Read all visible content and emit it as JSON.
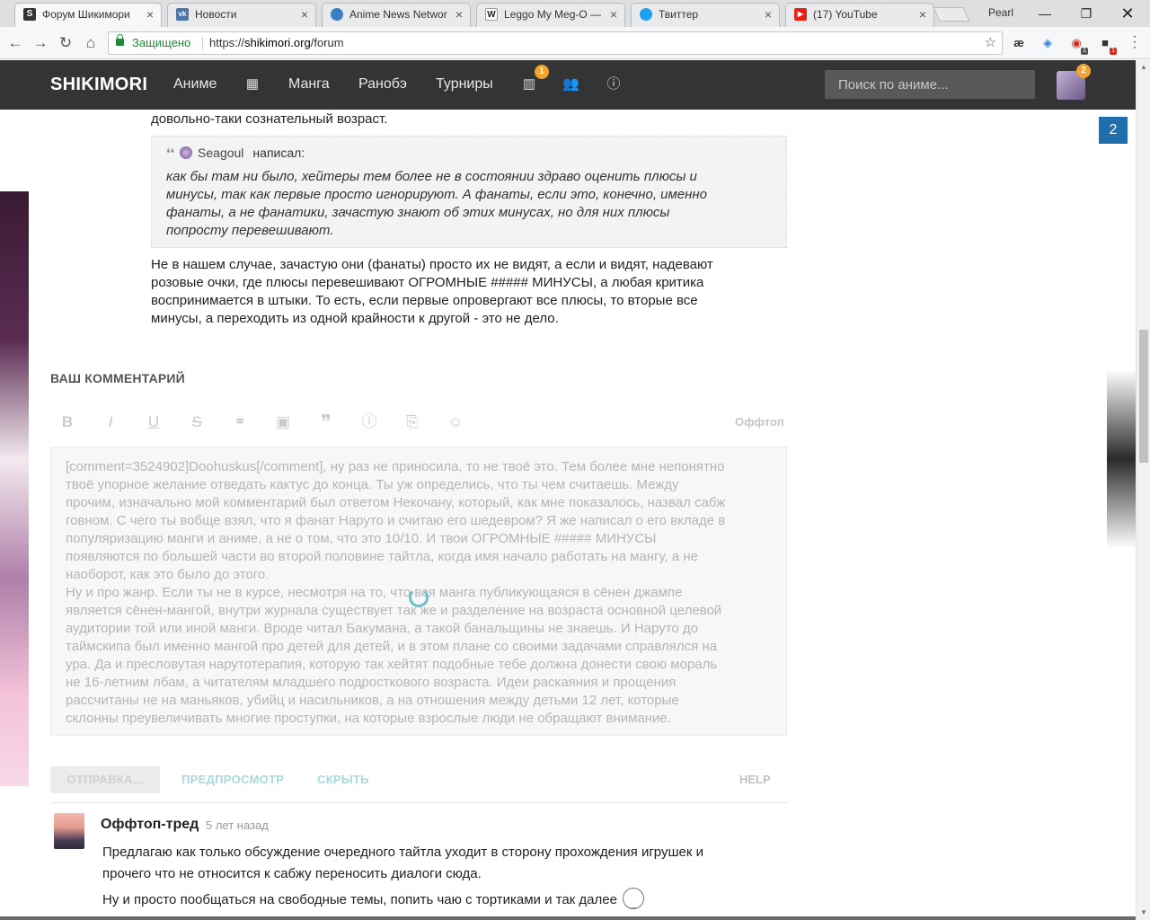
{
  "browser": {
    "tabs": [
      {
        "title": "Форум Шикимори",
        "favicon": "S",
        "color": "#343434"
      },
      {
        "title": "Новости",
        "favicon": "vk",
        "color": "#4a76a8"
      },
      {
        "title": "Anime News Networ",
        "favicon": "ann",
        "color": "#3a7fc1"
      },
      {
        "title": "Leggo My Meg-O —",
        "favicon": "W",
        "color": "#ffffff"
      },
      {
        "title": "Твиттер",
        "favicon": "twitter-bird",
        "color": "#1da1f2"
      },
      {
        "title": "(17) YouTube",
        "favicon": "youtube-play",
        "color": "#e62117"
      }
    ],
    "profile_name": "Pearl",
    "secure_label": "Защищено",
    "url_scheme": "https://",
    "url_host": "shikimori.org",
    "url_path": "/forum",
    "ext_icons": [
      "ae-icon",
      "shield-icon",
      "adblock-icon",
      "extension-icon"
    ],
    "ext_badges": [
      "1",
      "1"
    ]
  },
  "site": {
    "logo": "SHIKIMORI",
    "nav": [
      "Аниме",
      "Манга",
      "Ранобэ",
      "Турниры"
    ],
    "news_badge": "1",
    "avatar_badge": "2",
    "search_placeholder": "Поиск по аниме...",
    "counter": "2",
    "accent": "#1f6fae"
  },
  "prev_comment": {
    "top_line": "довольно-таки сознательный возраст.",
    "quote_user": "Seagoul",
    "quote_wrote": "написал:",
    "quote_lines": [
      "как бы там ни было, хейтеры тем более не в состоянии здраво оценить плюсы и",
      "минусы, так как первые просто игнорируют. А фанаты, если это, конечно, именно",
      "фанаты, а не фанатики, зачастую знают об этих минусах, но для них плюсы",
      "попросту перевешивают."
    ],
    "reply_lines": [
      "Не в нашем случае, зачастую они (фанаты) просто их не видят, а если и видят, надевают",
      "розовые очки, где плюсы перевешивают ОГРОМНЫЕ ##### МИНУСЫ, а любая критика",
      "воспринимается в штыки. То есть, если первые опровергают все плюсы, то вторые все",
      "минусы, а переходить из одной крайности к другой - это не дело."
    ]
  },
  "editor": {
    "section_title": "ВАШ КОММЕНТАРИЙ",
    "offtop_label": "Оффтоп",
    "lines": [
      "[comment=3524902]Doohuskus[/comment], ну раз не приносила, то не твоё это. Тем более мне непонятно",
      "твоё упорное желание отведать кактус до конца. Ты уж определись, что ты чем считаешь. Между",
      "прочим, изначально мой комментарий был ответом Некочану, который, как мне показалось, назвал сабж",
      "говном. С чего ты вобще взял, что я фанат Наруто и считаю его шедевром? Я же написал о его вкладе в",
      "популяризацию манги и аниме, а не о том, что это 10/10. И твои ОГРОМНЫЕ ##### МИНУСЫ",
      "появляются по большей части во второй половине тайтла, когда имя начало работать на мангу, а не",
      "наоборот, как это было до этого.",
      "Ну и про жанр. Если ты не в курсе, несмотря на то, что вся манга публикующаяся в сёнен джампе",
      "является сёнен-мангой, внутри журнала существует так же и разделение на возраста основной целевой",
      "аудитории той или иной манги. Вроде читал Бакумана, а такой банальщины не знаешь. И Наруто до",
      "таймскипа был именно мангой про детей для детей, и в этом плане со своими задачами справлялся на",
      "ура. Да и пресловутая нарутотерапия, которую так хейтят подобные тебе должна донести свою мораль",
      "не 16-летним лбам, а читателям младшего подросткового возраста. Идеи раскаяния и прощения",
      "рассчитаны не на маньяков, убийц и насильников, а на отношения между детьми 12 лет, которые",
      "склонны преувеличивать многие проступки, на которые взрослые люди не обращают внимание."
    ],
    "send_label": "ОТПРАВКА...",
    "preview_label": "ПРЕДПРОСМОТР",
    "hide_label": "СКРЫТЬ",
    "help_label": "HELP"
  },
  "thread": {
    "title": "Оффтоп-тред",
    "time": "5 лет назад",
    "lines": [
      "Предлагаю как только обсуждение очередного тайтла уходит в сторону прохождения игрушек и",
      "прочего что не относится к сабжу переносить диалоги сюда.",
      "Ну и просто пообщаться на свободные темы, попить чаю с тортиками и так далее"
    ]
  }
}
